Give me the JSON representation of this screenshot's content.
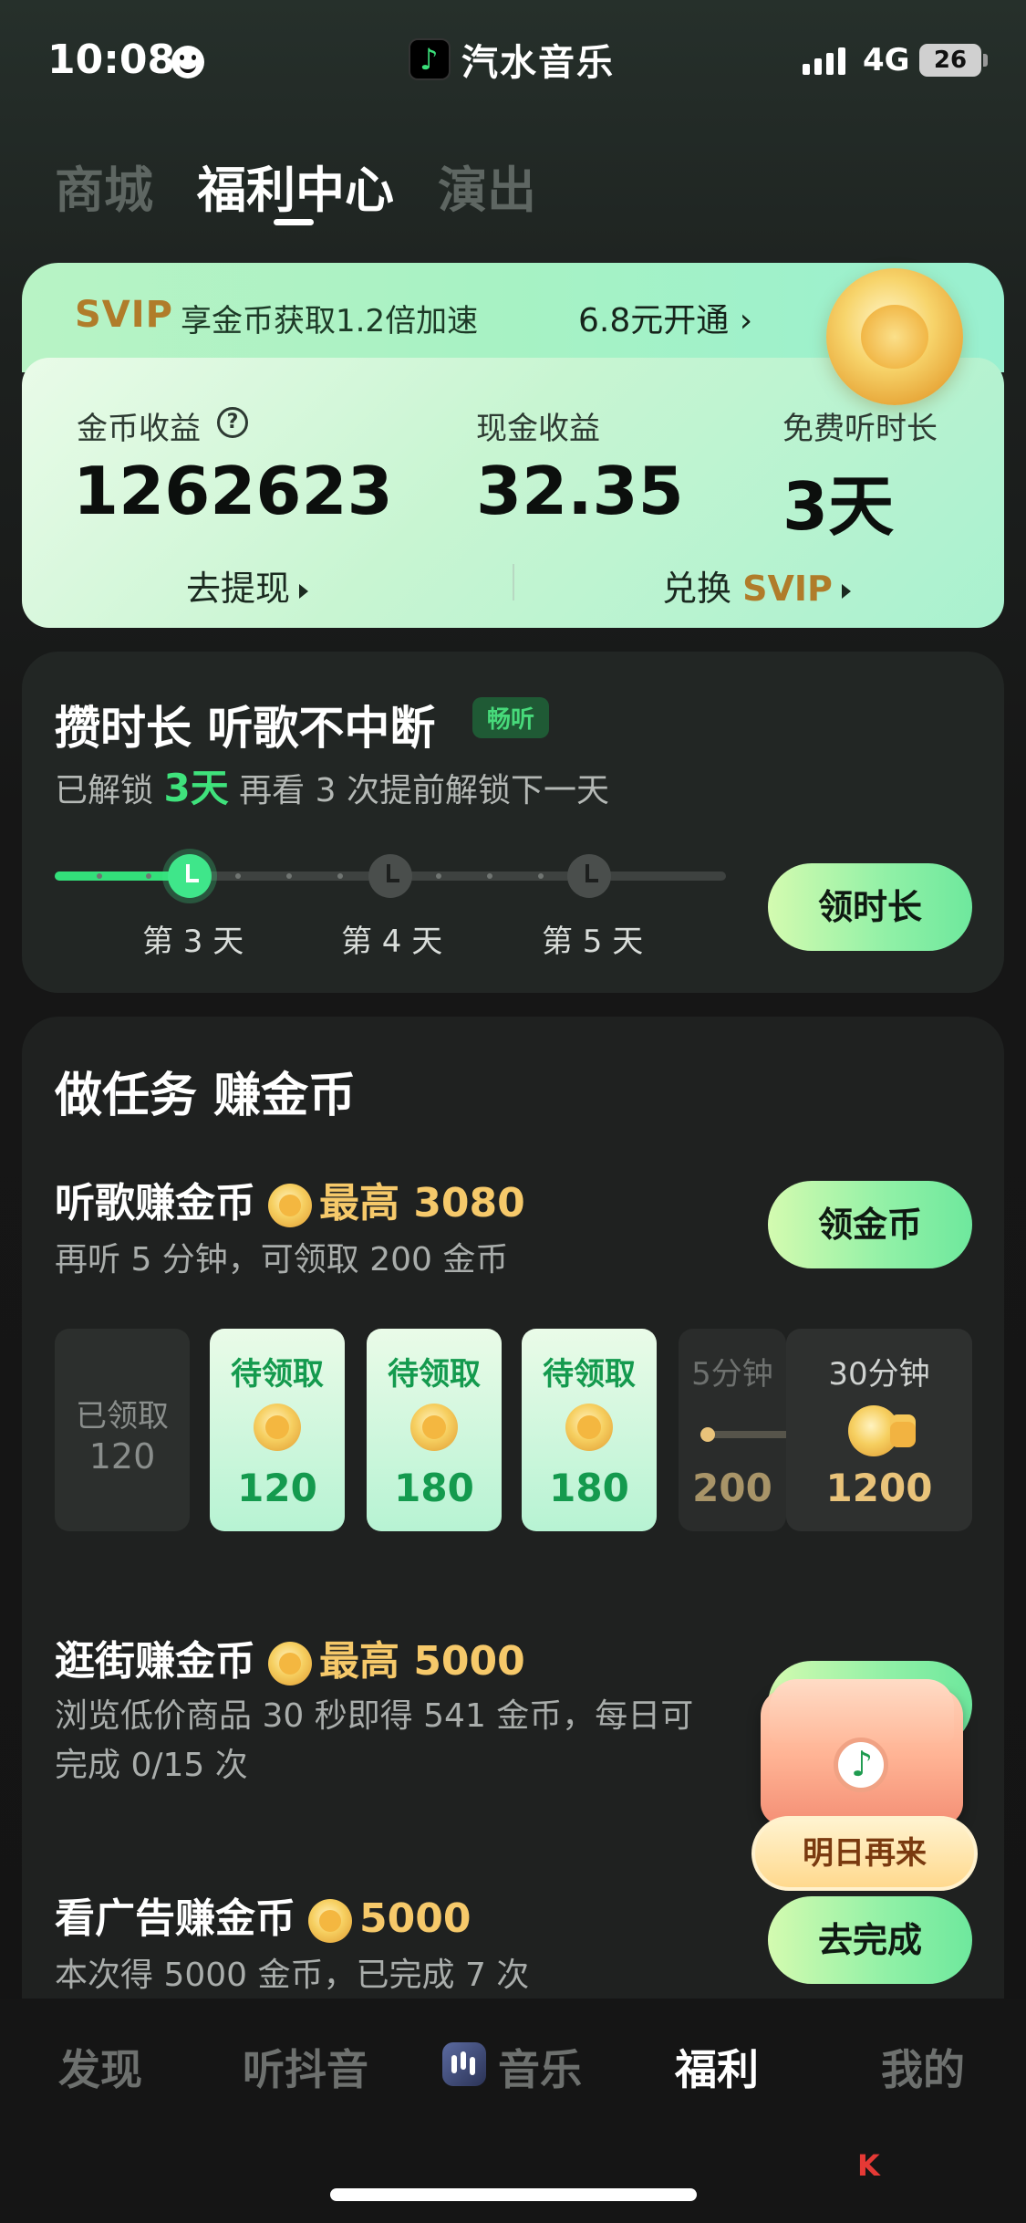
{
  "status_bar": {
    "time": "10:08",
    "network": "4G",
    "battery": "26"
  },
  "app": {
    "name": "汽水音乐"
  },
  "top_tabs": [
    {
      "label": "商城",
      "active": false
    },
    {
      "label": "福利中心",
      "active": true
    },
    {
      "label": "演出",
      "active": false
    }
  ],
  "svip_banner": {
    "tag": "SVIP",
    "text": "享金币获取1.2倍加速",
    "price_link": "6.8元开通 ›"
  },
  "earnings": {
    "coin_label": "金币收益",
    "help": "?",
    "coin_value": "1262623",
    "cash_label": "现金收益",
    "cash_value": "32.35",
    "free_label": "免费听时长",
    "free_value": "3天",
    "withdraw_link": "去提现",
    "exchange_prefix": "兑换",
    "exchange_svip": "SVIP"
  },
  "duration": {
    "title": "攒时长 听歌不中断",
    "badge": "畅听",
    "sub_prefix": "已解锁",
    "sub_days": "3天",
    "sub_suffix": "再看 3 次提前解锁下一天",
    "progress_days": [
      {
        "label": "第 3 天",
        "active": true
      },
      {
        "label": "第 4 天",
        "active": false
      },
      {
        "label": "第 5 天",
        "active": false
      }
    ],
    "claim_button": "领时长"
  },
  "tasks": {
    "title": "做任务 赚金币",
    "listen": {
      "name": "听歌赚金币",
      "max": "最高 3080",
      "desc": "再听 5 分钟，可领取 200 金币",
      "button": "领金币",
      "slots": [
        {
          "top": "已领取",
          "value": "120",
          "state": "done"
        },
        {
          "top": "待领取",
          "value": "120",
          "state": "pending"
        },
        {
          "top": "待领取",
          "value": "180",
          "state": "pending"
        },
        {
          "top": "待领取",
          "value": "180",
          "state": "pending"
        },
        {
          "top": "5分钟",
          "value": "200",
          "state": "locked"
        },
        {
          "top": "30分钟",
          "value": "1200",
          "state": "locked"
        }
      ]
    },
    "shop": {
      "name": "逛街赚金币",
      "max": "最高 5000",
      "desc_line1": "浏览低价商品 30 秒即得 541 金币，每日可",
      "desc_line2": "完成 0/15 次"
    },
    "ads": {
      "name": "看广告赚金币",
      "max": "5000",
      "desc": "本次得 5000 金币，已完成 7 次",
      "button": "去完成"
    }
  },
  "chest": {
    "button": "明日再来"
  },
  "bottom_nav": [
    {
      "label": "发现",
      "active": false
    },
    {
      "label": "听抖音",
      "active": false
    },
    {
      "label": "音乐",
      "active": false
    },
    {
      "label": "福利",
      "active": true
    },
    {
      "label": "我的",
      "active": false
    }
  ]
}
